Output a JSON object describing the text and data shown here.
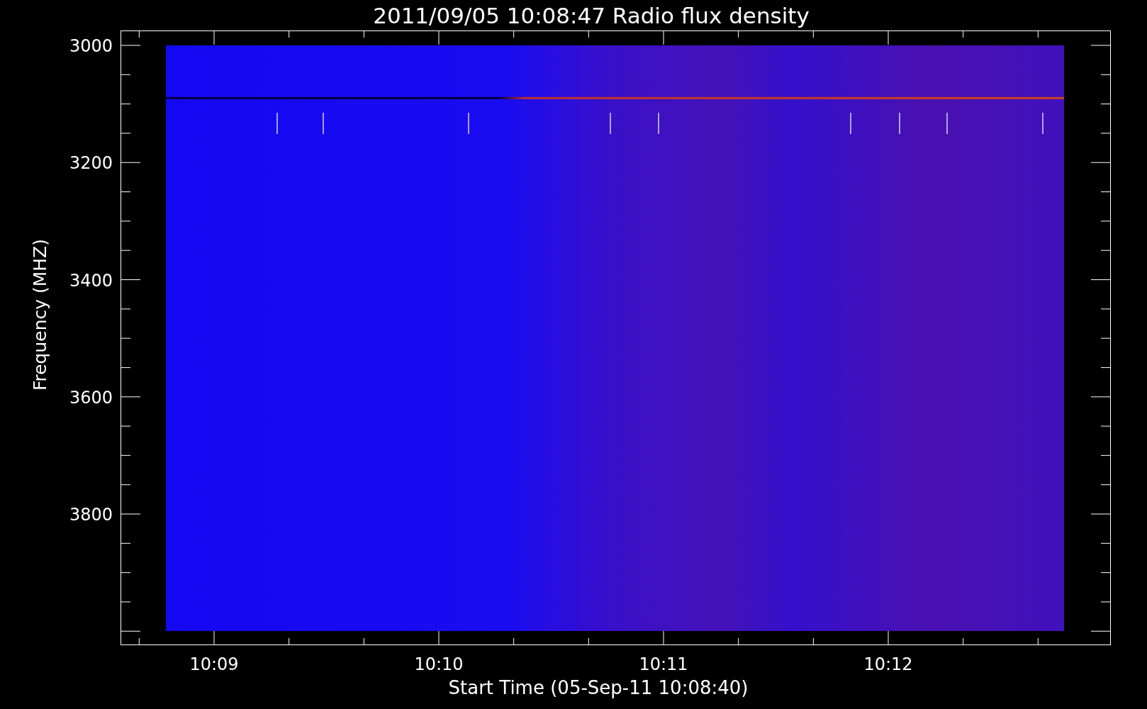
{
  "title": "2011/09/05 10:08:47 Radio flux density",
  "y_axis": {
    "label": "Frequency (MHZ)",
    "ticks": [
      "3000",
      "3200",
      "3400",
      "3600",
      "3800"
    ]
  },
  "x_axis": {
    "label": "Start Time (05-Sep-11 10:08:40)",
    "ticks": [
      "10:09",
      "10:10",
      "10:11",
      "10:12"
    ]
  }
}
